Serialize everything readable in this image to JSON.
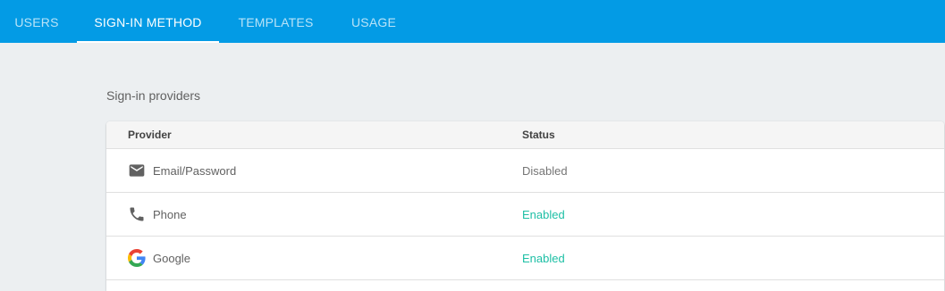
{
  "tabs": [
    {
      "label": "USERS",
      "active": false
    },
    {
      "label": "SIGN-IN METHOD",
      "active": true
    },
    {
      "label": "TEMPLATES",
      "active": false
    },
    {
      "label": "USAGE",
      "active": false
    }
  ],
  "section_title": "Sign-in providers",
  "table": {
    "columns": [
      "Provider",
      "Status"
    ],
    "rows": [
      {
        "provider": "Email/Password",
        "icon": "email-icon",
        "status": "Disabled"
      },
      {
        "provider": "Phone",
        "icon": "phone-icon",
        "status": "Enabled"
      },
      {
        "provider": "Google",
        "icon": "google-icon",
        "status": "Enabled"
      }
    ]
  },
  "colors": {
    "header_bar": "#039be5",
    "enabled": "#1dbfa5",
    "disabled": "#757575"
  }
}
